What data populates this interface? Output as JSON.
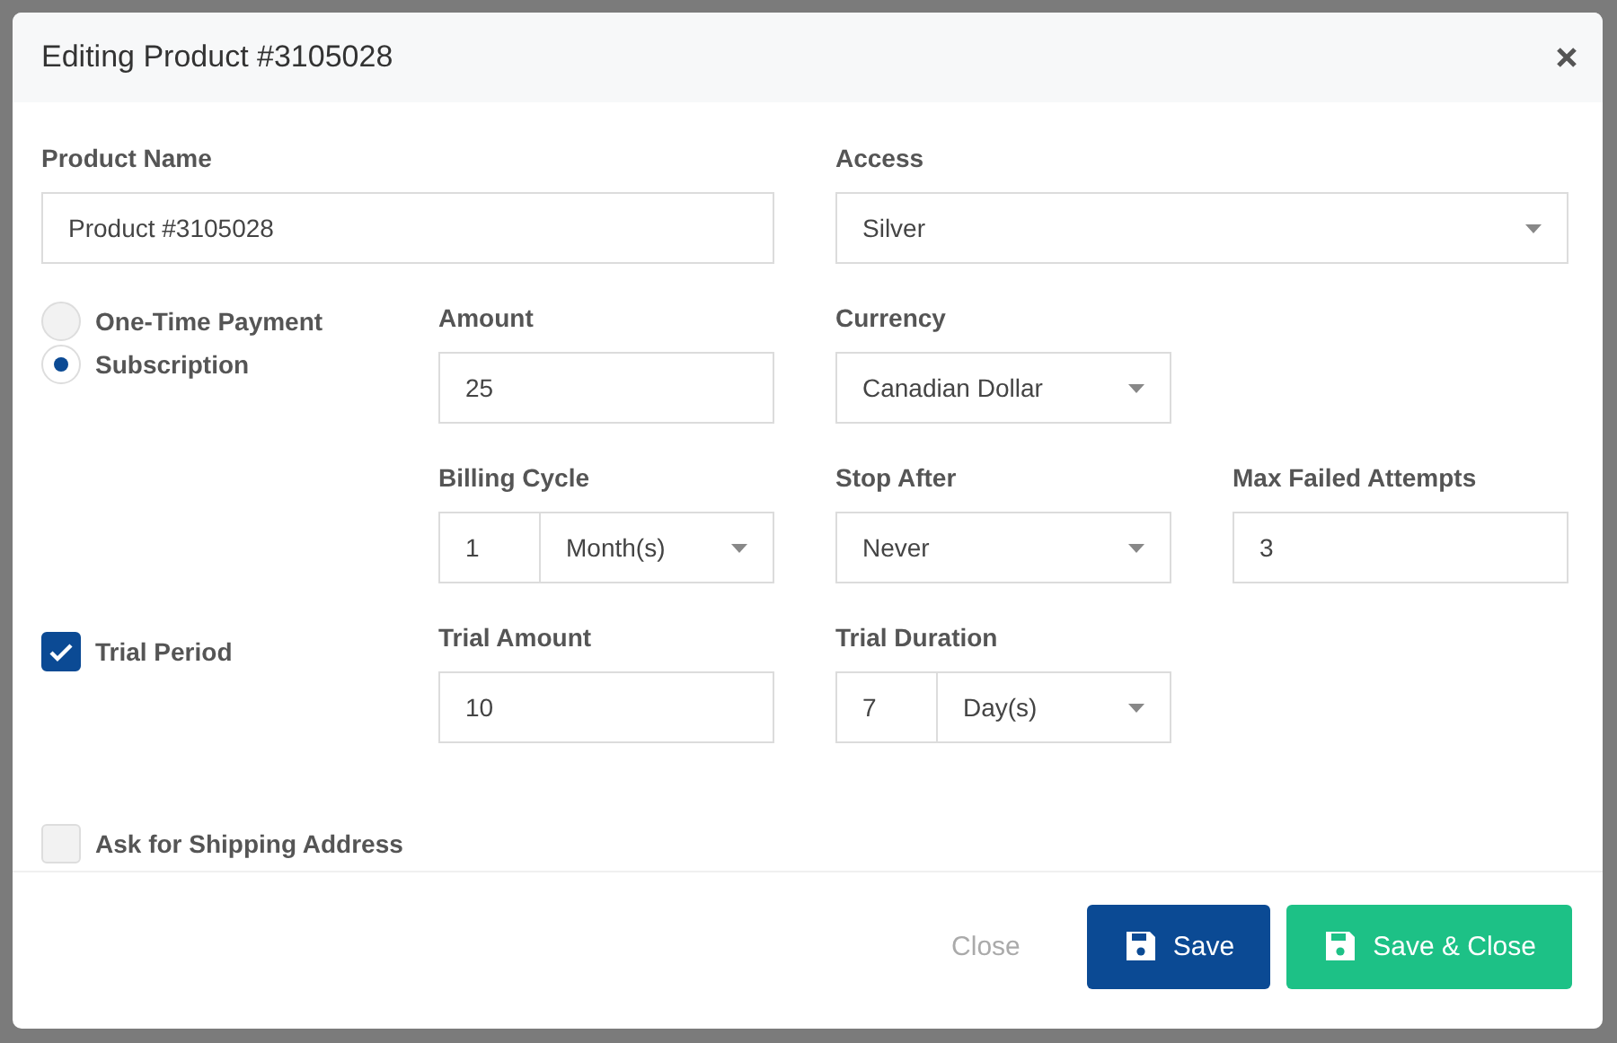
{
  "dialog": {
    "title": "Editing Product #3105028",
    "top_fields": [
      {
        "kind": "text",
        "label": "Product Name",
        "value": "Product #3105028"
      },
      {
        "kind": "select",
        "label": "Access",
        "value": "Silver"
      }
    ],
    "rows": [
      {
        "side": {
          "kind": "radio",
          "options": [
            {
              "label": "One-Time Payment",
              "selected": false
            },
            {
              "label": "Subscription",
              "selected": true
            }
          ]
        },
        "fields": [
          {
            "kind": "text",
            "label": "Amount",
            "value": "25"
          },
          {
            "kind": "select",
            "label": "Currency",
            "value": "Canadian Dollar"
          }
        ]
      },
      {
        "fields": [
          {
            "kind": "combo",
            "label": "Billing Cycle",
            "count": "1",
            "unit": "Month(s)"
          },
          {
            "kind": "select",
            "label": "Stop After",
            "value": "Never"
          },
          {
            "kind": "text",
            "label": "Max Failed Attempts",
            "value": "3"
          }
        ]
      },
      {
        "side": {
          "kind": "checkbox",
          "label": "Trial Period",
          "checked": true
        },
        "fields": [
          {
            "kind": "text",
            "label": "Trial Amount",
            "value": "10"
          },
          {
            "kind": "combo",
            "label": "Trial Duration",
            "count": "7",
            "unit": "Day(s)"
          }
        ]
      },
      {
        "side": {
          "kind": "checkbox",
          "label": "Ask for Shipping Address",
          "checked": false
        }
      }
    ],
    "buttons": [
      {
        "kind": "plain",
        "label": "Close"
      },
      {
        "kind": "primary",
        "label": "Save"
      },
      {
        "kind": "success",
        "label": "Save & Close"
      }
    ]
  }
}
